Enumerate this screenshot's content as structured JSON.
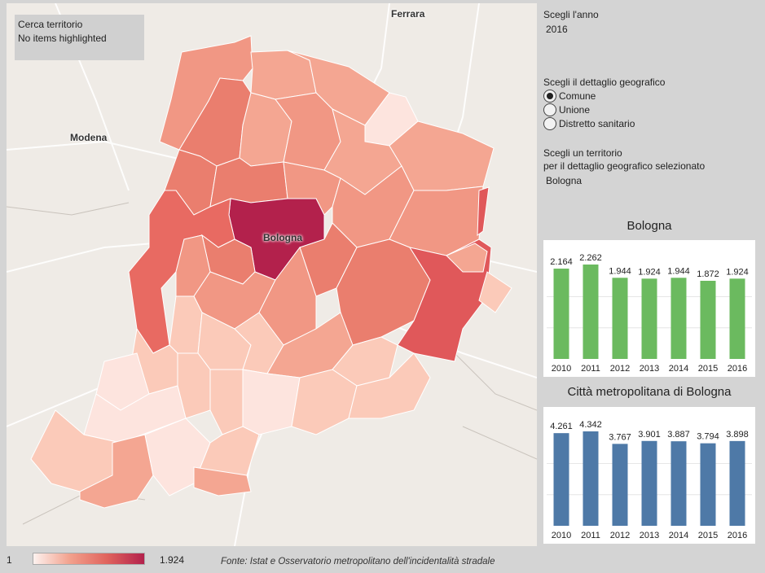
{
  "map": {
    "search_title": "Cerca territorio",
    "search_status": "No items highlighted",
    "places": {
      "ferrara": "Ferrara",
      "modena": "Modena",
      "bologna": "Bologna"
    },
    "fill_colors": {
      "low": "#fde4de",
      "mid": "#f4a692",
      "high": "#e0585a",
      "max": "#b3214c"
    }
  },
  "controls": {
    "year_label": "Scegli l'anno",
    "year_value": "2016",
    "geo_label": "Scegli il dettaglio geografico",
    "geo_options": [
      "Comune",
      "Unione",
      "Distretto sanitario"
    ],
    "geo_selected": "Comune",
    "territory_label_1": "Scegli un territorio",
    "territory_label_2": "per il dettaglio geografico selezionato",
    "territory_value": "Bologna"
  },
  "chart_data": [
    {
      "type": "bar",
      "title": "Bologna",
      "categories": [
        "2010",
        "2011",
        "2012",
        "2013",
        "2014",
        "2015",
        "2016"
      ],
      "values": [
        2164,
        2262,
        1944,
        1924,
        1944,
        1872,
        1924
      ],
      "labels": [
        "2.164",
        "2.262",
        "1.944",
        "1.924",
        "1.944",
        "1.872",
        "1.924"
      ],
      "color": "#6bba5f",
      "grid": true
    },
    {
      "type": "bar",
      "title": "Città metropolitana di Bologna",
      "categories": [
        "2010",
        "2011",
        "2012",
        "2013",
        "2014",
        "2015",
        "2016"
      ],
      "values": [
        4261,
        4342,
        3767,
        3901,
        3887,
        3794,
        3898
      ],
      "labels": [
        "4.261",
        "4.342",
        "3.767",
        "3.901",
        "3.887",
        "3.794",
        "3.898"
      ],
      "color": "#4e79a7",
      "grid": true
    }
  ],
  "legend": {
    "min": "1",
    "max": "1.924",
    "source": "Fonte: Istat e Osservatorio metropolitano dell'incidentalità stradale"
  }
}
